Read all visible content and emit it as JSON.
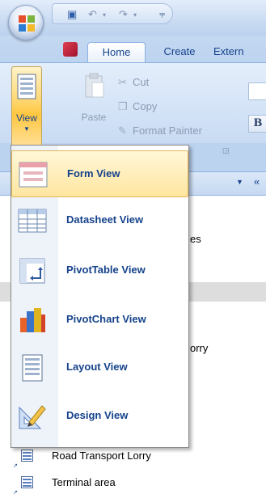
{
  "ribbon": {
    "tabs": [
      {
        "label": "Home"
      },
      {
        "label": "Create"
      },
      {
        "label": "Extern"
      }
    ],
    "view_button_label": "View",
    "paste_label": "Paste",
    "clipboard": {
      "cut_label": "Cut",
      "copy_label": "Copy",
      "format_painter_label": "Format Painter"
    },
    "bold_label": "B"
  },
  "view_menu": {
    "items": [
      {
        "label": "Form View",
        "icon": "form-view-icon",
        "hovered": true
      },
      {
        "label": "Datasheet View",
        "icon": "datasheet-view-icon"
      },
      {
        "label": "PivotTable View",
        "icon": "pivottable-view-icon"
      },
      {
        "label": "PivotChart View",
        "icon": "pivotchart-view-icon"
      },
      {
        "label": "Layout View",
        "icon": "layout-view-icon"
      },
      {
        "label": "Design View",
        "icon": "design-view-icon"
      }
    ]
  },
  "nav_pane": {
    "partial_texts": [
      "es",
      "orry"
    ],
    "items": [
      {
        "label": "Road Transport Lorry",
        "icon": "form-shortcut-icon"
      },
      {
        "label": "Terminal area",
        "icon": "form-shortcut-icon"
      }
    ]
  },
  "colors": {
    "ribbon_text": "#15428b",
    "hover_fill": "#ffe6a0",
    "selection_band": "#dddddd"
  }
}
